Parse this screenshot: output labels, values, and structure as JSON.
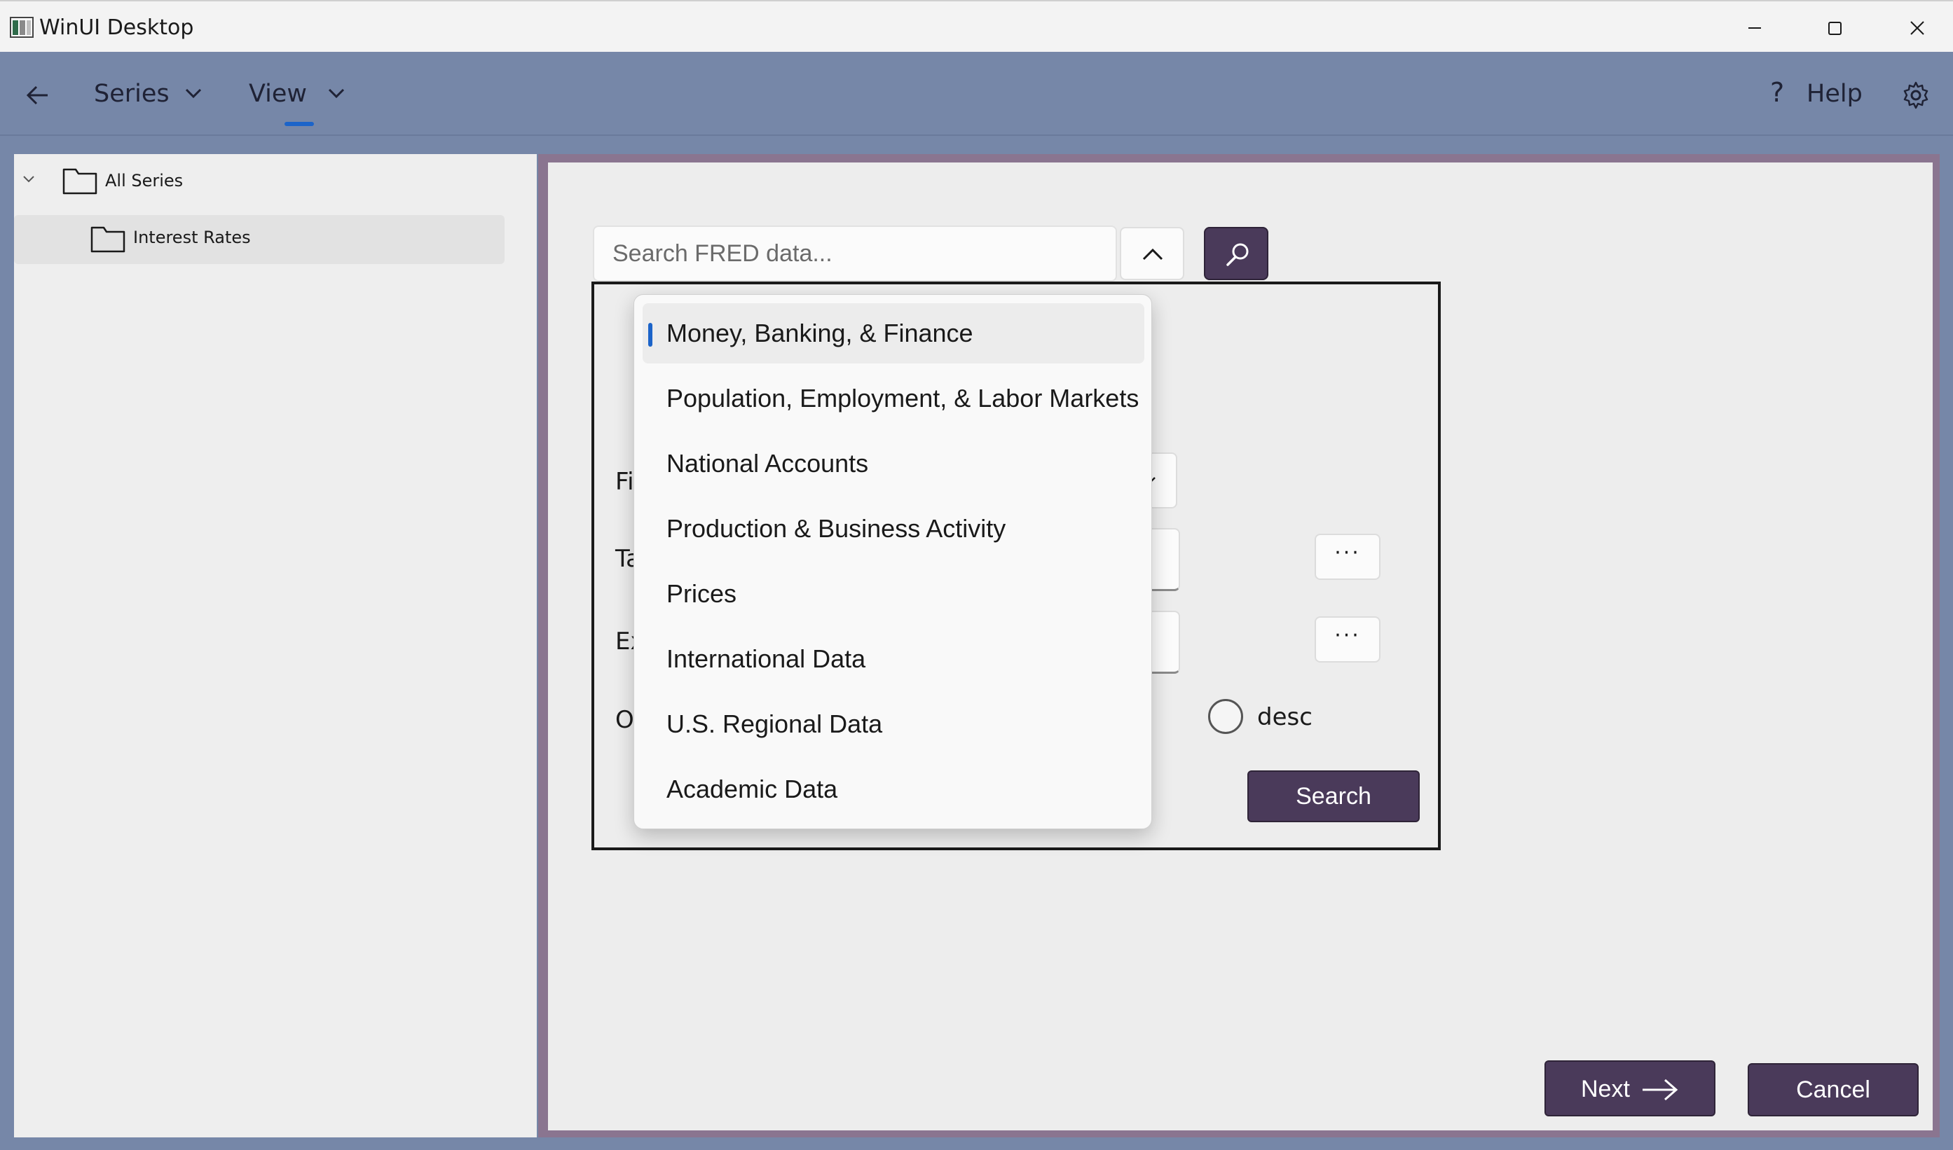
{
  "window": {
    "title": "WinUI Desktop"
  },
  "nav": {
    "series_label": "Series",
    "view_label": "View",
    "help_label": "Help"
  },
  "tree": {
    "root_label": "All Series",
    "child_label": "Interest Rates"
  },
  "search": {
    "placeholder": "Search FRED data..."
  },
  "form": {
    "row_labels": [
      "Fi",
      "Ta",
      "Ex",
      "O"
    ],
    "more_label": "···",
    "radio_desc_label": "desc",
    "search_button_label": "Search"
  },
  "dropdown": {
    "items": [
      "Money, Banking, & Finance",
      "Population, Employment, & Labor Markets",
      "National Accounts",
      "Production & Business Activity",
      "Prices",
      "International Data",
      "U.S. Regional Data",
      "Academic Data"
    ],
    "selected_index": 0
  },
  "footer": {
    "next_label": "Next",
    "cancel_label": "Cancel"
  },
  "colors": {
    "nav_background": "#7687a8",
    "accent_purple": "#4a3a5a",
    "selection_indicator": "#1c64c9"
  }
}
